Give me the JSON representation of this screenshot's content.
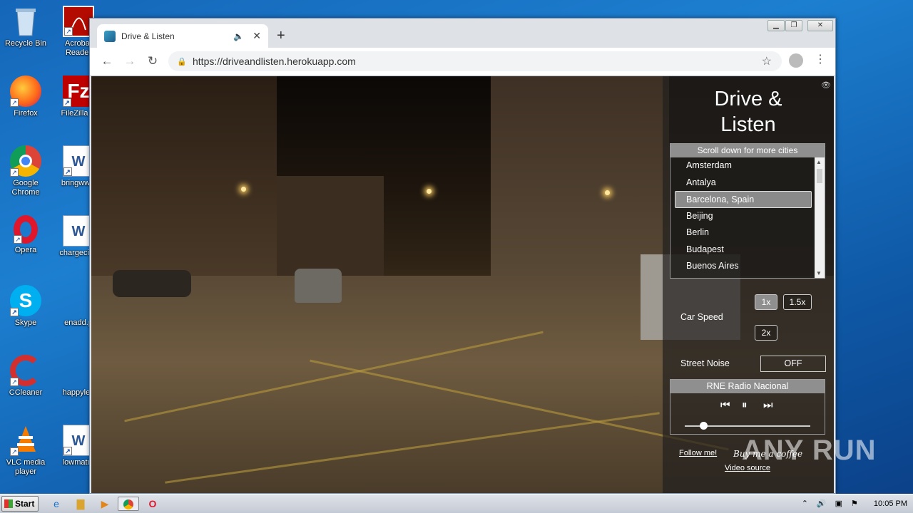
{
  "desktop": {
    "icons": [
      {
        "label": "Recycle Bin",
        "icon": "recycle-bin-icon"
      },
      {
        "label": "Acrobat Reader",
        "icon": "acrobat-icon"
      },
      {
        "label": "Firefox",
        "icon": "firefox-icon"
      },
      {
        "label": "FileZilla C",
        "icon": "filezilla-icon"
      },
      {
        "label": "Google Chrome",
        "icon": "chrome-icon"
      },
      {
        "label": "bringwww",
        "icon": "word-doc-icon"
      },
      {
        "label": "Opera",
        "icon": "opera-icon"
      },
      {
        "label": "chargecive",
        "icon": "word-doc-icon"
      },
      {
        "label": "Skype",
        "icon": "skype-icon"
      },
      {
        "label": "enadd.p",
        "icon": "file-icon"
      },
      {
        "label": "CCleaner",
        "icon": "ccleaner-icon"
      },
      {
        "label": "happylea",
        "icon": "file-icon"
      },
      {
        "label": "VLC media player",
        "icon": "vlc-icon"
      },
      {
        "label": "lowmatur",
        "icon": "word-doc-icon"
      }
    ]
  },
  "browser": {
    "tab_title": "Drive & Listen",
    "new_tab": "+",
    "url": "https://driveandlisten.herokuapp.com"
  },
  "app": {
    "title_line1": "Drive &",
    "title_line2": "Listen",
    "city_header": "Scroll down for more cities",
    "cities": [
      "Amsterdam",
      "Antalya",
      "Barcelona, Spain",
      "Beijing",
      "Berlin",
      "Budapest",
      "Buenos Aires"
    ],
    "selected_city": "Barcelona, Spain",
    "speed_label": "Car Speed",
    "speed_1x": "1x",
    "speed_15x": "1.5x",
    "speed_2x": "2x",
    "active_speed": "1x",
    "noise_label": "Street Noise",
    "noise_value": "OFF",
    "radio_station": "RNE Radio Nacional",
    "volume": 0.15,
    "follow_link": "Follow me!",
    "coffee_link": "Buy me a coffee",
    "video_source": "Video source"
  },
  "taskbar": {
    "start": "Start",
    "clock": "10:05 PM"
  },
  "watermark": "ANY RUN"
}
